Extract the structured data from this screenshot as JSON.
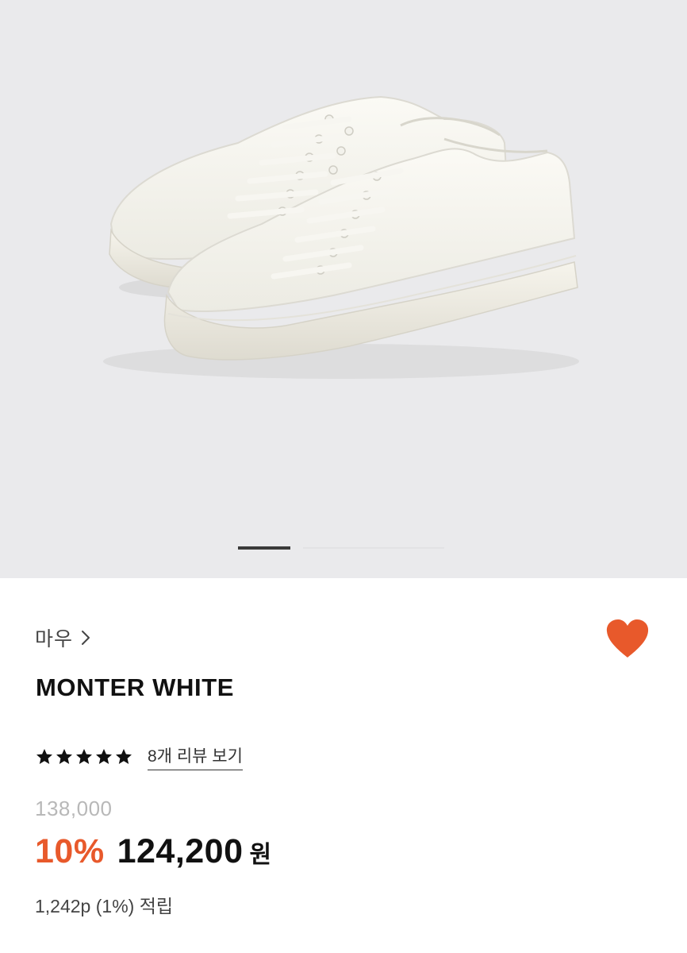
{
  "gallery": {
    "image_subject": "white canvas low-top sneakers",
    "pager": {
      "current": 1
    },
    "background_color": "#eaeaec"
  },
  "product": {
    "brand": "마우",
    "title": "MONTER WHITE",
    "rating_stars": 5,
    "review_link": "8개 리뷰 보기",
    "original_price": "138,000",
    "discount_rate": "10%",
    "sale_price": "124,200",
    "currency": "원",
    "points": "1,242p (1%) 적립"
  },
  "icons": {
    "brand_chevron": "chevron-right-icon",
    "wishlist": "heart-icon",
    "rating": "star-icon"
  },
  "colors": {
    "accent": "#e8592b",
    "text": "#111111",
    "muted": "#b8b8b8"
  }
}
